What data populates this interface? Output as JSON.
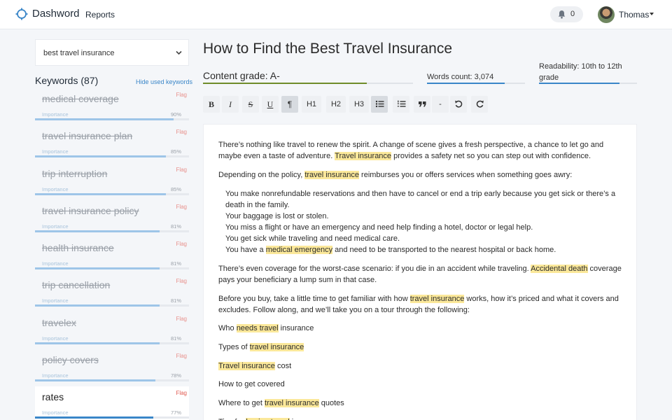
{
  "header": {
    "brand": "Dashword",
    "nav_reports": "Reports",
    "notifications_count": "0",
    "user_name": "Thomas"
  },
  "sidebar": {
    "selected_query": "best travel insurance",
    "keywords_title": "Keywords (87)",
    "hide_used_label": "Hide used keywords",
    "importance_label": "Importance",
    "flag_label": "Flag",
    "keywords": [
      {
        "name": "medical coverage",
        "importance": "90%",
        "fill": 0.9,
        "used": true
      },
      {
        "name": "travel insurance plan",
        "importance": "85%",
        "fill": 0.85,
        "used": true
      },
      {
        "name": "trip interruption",
        "importance": "85%",
        "fill": 0.85,
        "used": true
      },
      {
        "name": "travel insurance policy",
        "importance": "81%",
        "fill": 0.81,
        "used": true
      },
      {
        "name": "health insurance",
        "importance": "81%",
        "fill": 0.81,
        "used": true
      },
      {
        "name": "trip cancellation",
        "importance": "81%",
        "fill": 0.81,
        "used": true
      },
      {
        "name": "travelex",
        "importance": "81%",
        "fill": 0.81,
        "used": true
      },
      {
        "name": "policy covers",
        "importance": "78%",
        "fill": 0.78,
        "used": true
      },
      {
        "name": "rates",
        "importance": "77%",
        "fill": 0.77,
        "used": false
      }
    ]
  },
  "main": {
    "title": "How to Find the Best Travel Insurance",
    "content_grade": "Content grade: A-",
    "content_grade_fill": 0.78,
    "words_count": "Words count: 3,074",
    "words_fill": 0.79,
    "readability": "Readability: 10th to 12th grade",
    "readability_fill": 0.82,
    "toolbar": [
      {
        "name": "bold-button",
        "label": "B",
        "active": false
      },
      {
        "name": "italic-button",
        "label": "I",
        "active": false
      },
      {
        "name": "strikethrough-button",
        "label": "S",
        "active": false
      },
      {
        "name": "underline-button",
        "label": "U",
        "active": false
      },
      {
        "name": "paragraph-button",
        "label": "¶",
        "active": true
      },
      {
        "name": "h1-button",
        "label": "H1",
        "active": false
      },
      {
        "name": "h2-button",
        "label": "H2",
        "active": false
      },
      {
        "name": "h3-button",
        "label": "H3",
        "active": false
      },
      {
        "name": "bullet-list-button",
        "icon": "bullet-list-icon",
        "active": true
      },
      {
        "name": "numbered-list-button",
        "icon": "numbered-list-icon",
        "active": false
      },
      {
        "name": "quote-button",
        "icon": "quote-icon",
        "active": false
      },
      {
        "name": "divider-button",
        "label": "-",
        "active": false
      },
      {
        "name": "undo-button",
        "icon": "undo-icon",
        "active": false
      },
      {
        "name": "redo-button",
        "icon": "redo-icon",
        "active": false
      }
    ],
    "paragraphs": [
      {
        "indent": false,
        "parts": [
          {
            "t": "There’s nothing like travel to renew the spirit. A change of scene gives a fresh perspective, a chance to let go and maybe even a taste of adventure. "
          },
          {
            "t": "Travel insurance",
            "hl": true
          },
          {
            "t": " provides a safety net so you can step out with confidence."
          }
        ]
      },
      {
        "indent": false,
        "parts": [
          {
            "t": "Depending on the policy, "
          },
          {
            "t": "travel insurance",
            "hl": true
          },
          {
            "t": " reimburses you or offers services when something goes awry:"
          }
        ]
      },
      {
        "indent": true,
        "parts": [
          {
            "t": "You make nonrefundable reservations and then have to cancel or end a trip early because you get sick or there’s a death in the family."
          }
        ]
      },
      {
        "indent": true,
        "parts": [
          {
            "t": "Your baggage is lost or stolen."
          }
        ]
      },
      {
        "indent": true,
        "parts": [
          {
            "t": "You miss a flight or have an emergency and need help finding a hotel, doctor or legal help."
          }
        ]
      },
      {
        "indent": true,
        "parts": [
          {
            "t": "You get sick while traveling and need medical care."
          }
        ]
      },
      {
        "indent": true,
        "parts": [
          {
            "t": "You have a "
          },
          {
            "t": "medical emergency",
            "hl": true
          },
          {
            "t": " and need to be transported to the nearest hospital or back home."
          }
        ]
      },
      {
        "indent": false,
        "parts": [
          {
            "t": "There’s even coverage for the worst-case scenario: if you die in an accident while traveling. "
          },
          {
            "t": "Accidental death",
            "hl": true
          },
          {
            "t": " coverage pays your beneficiary a lump sum in that case."
          }
        ]
      },
      {
        "indent": false,
        "parts": [
          {
            "t": "Before you buy, take a little time to get familiar with how "
          },
          {
            "t": "travel insurance",
            "hl": true
          },
          {
            "t": " works, how it’s priced and what it covers and excludes. Follow along, and we’ll take you on a tour through the following:"
          }
        ]
      },
      {
        "indent": false,
        "parts": [
          {
            "t": "Who "
          },
          {
            "t": "needs travel",
            "hl": true
          },
          {
            "t": " insurance"
          }
        ]
      },
      {
        "indent": false,
        "parts": [
          {
            "t": "Types of "
          },
          {
            "t": "travel insurance",
            "hl": true
          }
        ]
      },
      {
        "indent": false,
        "parts": [
          {
            "t": "Travel insurance",
            "hl": true
          },
          {
            "t": " cost"
          }
        ]
      },
      {
        "indent": false,
        "parts": [
          {
            "t": "How to get covered"
          }
        ]
      },
      {
        "indent": false,
        "parts": [
          {
            "t": "Where to get "
          },
          {
            "t": "travel insurance",
            "hl": true
          },
          {
            "t": " quotes"
          }
        ]
      },
      {
        "indent": false,
        "parts": [
          {
            "t": "Tips for "
          },
          {
            "t": "buying travel",
            "hl": true
          },
          {
            "t": " insurance"
          }
        ]
      }
    ]
  }
}
